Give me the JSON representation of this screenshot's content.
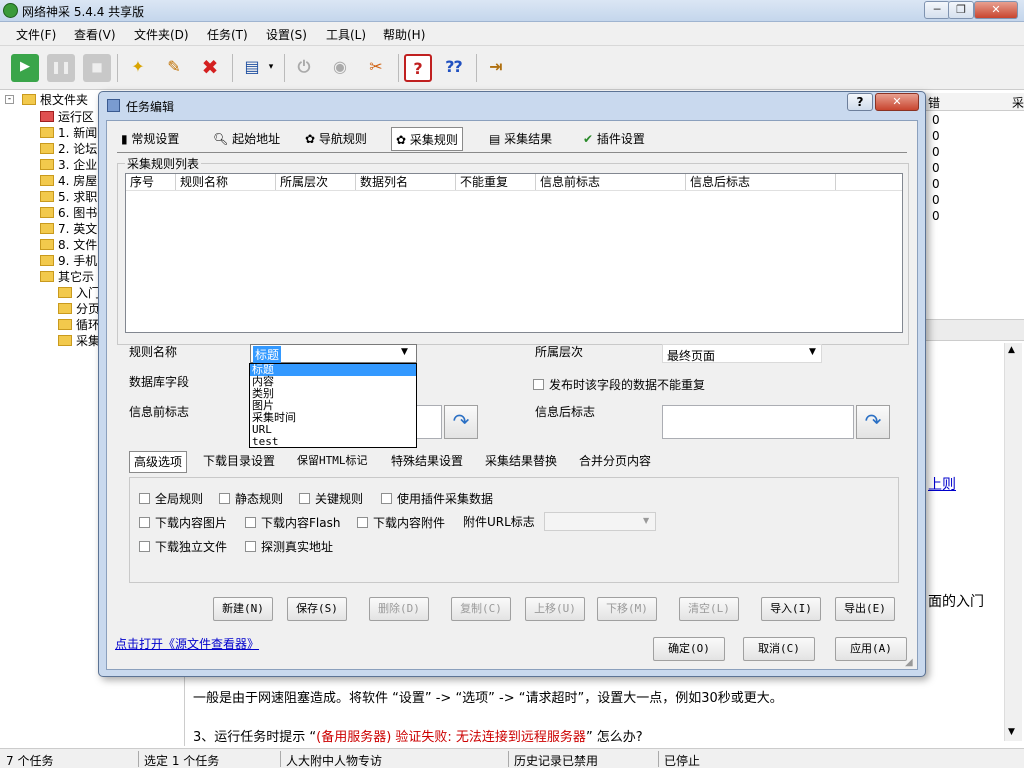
{
  "app": {
    "title": "网络神采 5.4.4 共享版",
    "min": "─",
    "max": "❐",
    "close": "✕"
  },
  "menu": [
    "文件(F)",
    "查看(V)",
    "文件夹(D)",
    "任务(T)",
    "设置(S)",
    "工具(L)",
    "帮助(H)"
  ],
  "tree": {
    "root": "根文件夹",
    "items": [
      "运行区",
      "1. 新闻",
      "2. 论坛",
      "3. 企业",
      "4. 房屋",
      "5. 求职",
      "6. 图书",
      "7. 英文",
      "8. 文件",
      "9. 手机"
    ],
    "other": "其它示",
    "other_children": [
      "入门",
      "分页",
      "循环",
      "采集"
    ]
  },
  "background": {
    "col_cuo": "错",
    "col_cai": "采",
    "zeros": [
      "0",
      "0",
      "0",
      "0",
      "0",
      "0",
      "0"
    ],
    "link1": "上则",
    "text1": "面的入门",
    "para1": "一般是由于网速阻塞造成。将软件 “设置” -> “选项” -> “请求超时”，设置大一点，例如30秒或更大。",
    "para2_a": "3、运行任务时提示 “",
    "para2_b": "(备用服务器) 验证失败: 无法连接到远程服务器",
    "para2_c": "” 怎么办?"
  },
  "status": [
    "7 个任务",
    "选定 1 个任务",
    "人大附中人物专访",
    "历史记录已禁用",
    "已停止"
  ],
  "dialog": {
    "title": "任务编辑",
    "help_btn": "?",
    "close_btn": "✕",
    "tabs": [
      "常规设置",
      "起始地址",
      "导航规则",
      "采集规则",
      "采集结果",
      "插件设置"
    ],
    "active_tab": "采集规则",
    "list_group": "采集规则列表",
    "columns": [
      "序号",
      "规则名称",
      "所属层次",
      "数据列名",
      "不能重复",
      "信息前标志",
      "信息后标志"
    ],
    "rule_name_label": "规则名称",
    "rule_name_value": "标题",
    "rule_name_options": [
      "标题",
      "内容",
      "类别",
      "图片",
      "采集时间",
      "URL",
      "test"
    ],
    "level_label": "所属层次",
    "level_value": "最终页面",
    "db_field_label": "数据库字段",
    "no_repeat_label": "发布时该字段的数据不能重复",
    "prefix_label": "信息前标志",
    "suffix_label": "信息后标志",
    "sub_tabs": [
      "高级选项",
      "下载目录设置",
      "保留HTML标记",
      "特殊结果设置",
      "采集结果替换",
      "合并分页内容"
    ],
    "checkboxes_row1": [
      "全局规则",
      "静态规则",
      "关键规则",
      "使用插件采集数据"
    ],
    "checkboxes_row2": [
      "下载内容图片",
      "下载内容Flash",
      "下载内容附件"
    ],
    "attach_url_label": "附件URL标志",
    "checkboxes_row3": [
      "下载独立文件",
      "探测真实地址"
    ],
    "buttons": [
      "新建(N)",
      "保存(S)",
      "删除(D)",
      "复制(C)",
      "上移(U)",
      "下移(M)",
      "清空(L)",
      "导入(I)",
      "导出(E)"
    ],
    "open_link": "点击打开《源文件查看器》",
    "ok": "确定(O)",
    "cancel": "取消(C)",
    "apply": "应用(A)"
  },
  "colors": {
    "accent": "#3399ff",
    "link": "#0000cc",
    "error_text": "#cc0000"
  }
}
